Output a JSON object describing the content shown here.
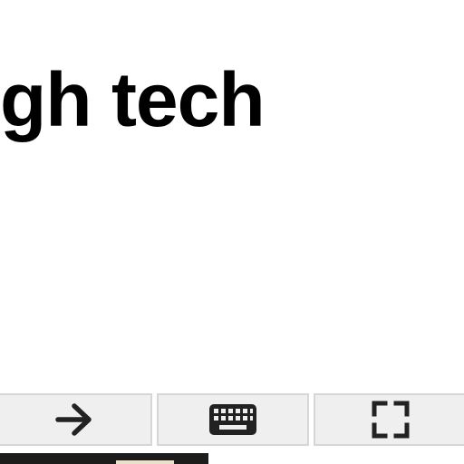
{
  "content": {
    "headline": "gh tech"
  },
  "toolbar": {
    "buttons": [
      {
        "icon": "arrow-right-icon"
      },
      {
        "icon": "keyboard-icon"
      },
      {
        "icon": "fullscreen-icon"
      }
    ],
    "button_bg": "#efefef",
    "icon_color": "#222222"
  }
}
